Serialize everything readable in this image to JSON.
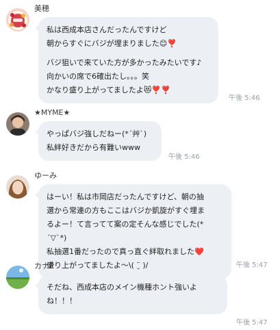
{
  "messages": [
    {
      "sender": "美穂",
      "avatar": "cake-avatar",
      "paragraphs": [
        [
          "私は西成本店さんだったんですけど",
          "朝からすぐにバジが埋まりました😊❣️"
        ],
        [
          "バジ狙いで来ていた方が多かったみたいです♪",
          "向かいの席で6確出たし。。。笑",
          "かなり盛り上がってましたよ😻❣️❣️"
        ]
      ],
      "time": "午後 5:46"
    },
    {
      "sender": "★MYME★",
      "avatar": "person-avatar",
      "paragraphs": [
        [
          "やっぱバジ強しだねー(*´艸`)",
          "私絆好きだから有難いwww"
        ]
      ],
      "time": "午後 5:46"
    },
    {
      "sender": "ゆーみ",
      "avatar": "woman-avatar",
      "paragraphs": [
        [
          "はーい！私は市岡店だったんですけど、朝の抽",
          "選から常連の方もここはバジか凱旋がすぐ埋ま",
          "るよー！て言ってて案の定そんな感じでした(*",
          "´▽`*)",
          "私抽選1番だったので真っ直ぐ絆取れました❤️",
          "盛り上がってましたよ〜\\( ¨̮ )/"
        ]
      ],
      "time": "午後 5:47"
    },
    {
      "sender": "カナP",
      "avatar": "landscape-avatar",
      "paragraphs": [
        [
          "そだね、西成本店のメイン機種ホント強いよ",
          "ね！！！"
        ]
      ],
      "time": "午後 5:47"
    }
  ]
}
